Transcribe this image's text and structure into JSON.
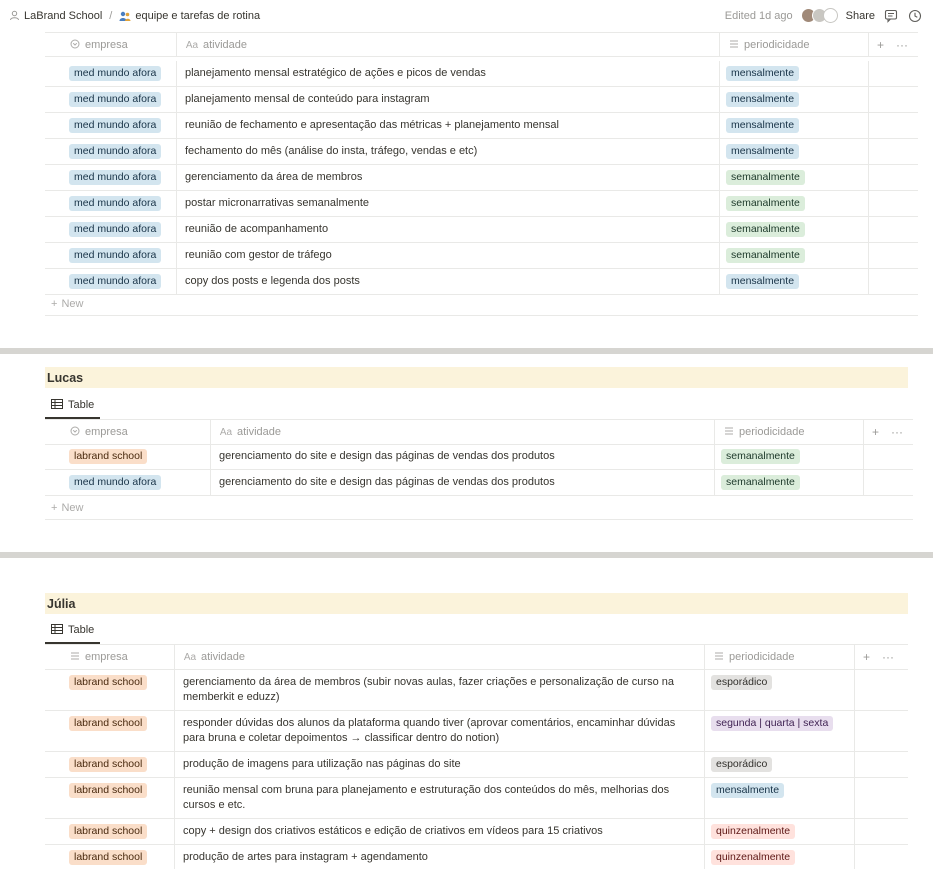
{
  "topbar": {
    "workspace": "LaBrand School",
    "separator": "/",
    "page": "equipe e tarefas de rotina",
    "edited": "Edited 1d ago",
    "share": "Share"
  },
  "icons": {
    "workspace": "user-icon",
    "page": "people-icon",
    "comments": "comment-icon",
    "history": "clock-icon",
    "select_prop": "select-property-icon",
    "title_prop": "text-property-icon",
    "multi_prop": "list-property-icon",
    "add": "plus-icon",
    "more": "ellipsis-icon",
    "table_view": "table-icon"
  },
  "columns": {
    "empresa": "empresa",
    "atividade": "atividade",
    "periodicidade": "periodicidade",
    "title_prefix": "Aa"
  },
  "new_label": "New",
  "plus": "+",
  "dots": "···",
  "table1": {
    "rows": [
      {
        "empresa": "med mundo afora",
        "atividade": "planejamento mensal estratégico de ações e picos de vendas",
        "periodicidade": "mensalmente"
      },
      {
        "empresa": "med mundo afora",
        "atividade": "planejamento mensal de conteúdo para instagram",
        "periodicidade": "mensalmente"
      },
      {
        "empresa": "med mundo afora",
        "atividade": "reunião de fechamento e apresentação das métricas + planejamento mensal",
        "periodicidade": "mensalmente"
      },
      {
        "empresa": "med mundo afora",
        "atividade": "fechamento do mês (análise do insta, tráfego, vendas e etc)",
        "periodicidade": "mensalmente"
      },
      {
        "empresa": "med mundo afora",
        "atividade": "gerenciamento da área de membros",
        "periodicidade": "semanalmente"
      },
      {
        "empresa": "med mundo afora",
        "atividade": "postar micronarrativas semanalmente",
        "periodicidade": "semanalmente"
      },
      {
        "empresa": "med mundo afora",
        "atividade": "reunião de acompanhamento",
        "periodicidade": "semanalmente"
      },
      {
        "empresa": "med mundo afora",
        "atividade": "reunião com gestor de tráfego",
        "periodicidade": "semanalmente"
      },
      {
        "empresa": "med mundo afora",
        "atividade": "copy dos posts e legenda dos posts",
        "periodicidade": "mensalmente"
      }
    ]
  },
  "lucas": {
    "title": "Lucas",
    "view": "Table",
    "rows": [
      {
        "empresa": "labrand school",
        "atividade": "gerenciamento do site e design das páginas de vendas dos produtos",
        "periodicidade": "semanalmente"
      },
      {
        "empresa": "med mundo afora",
        "atividade": "gerenciamento do site e design das páginas de vendas dos produtos",
        "periodicidade": "semanalmente"
      }
    ]
  },
  "julia": {
    "title": "Júlia",
    "view": "Table",
    "rows": [
      {
        "empresa": "labrand school",
        "atividade": "gerenciamento da área de membros (subir novas aulas, fazer criações e personalização de curso na memberkit e eduzz)",
        "periodicidade": "esporádico"
      },
      {
        "empresa": "labrand school",
        "atividade": "responder dúvidas dos alunos da plataforma quando tiver (aprovar comentários, encaminhar dúvidas para bruna e coletar depoimentos → classificar dentro do notion)",
        "periodicidade": "segunda | quarta | sexta"
      },
      {
        "empresa": "labrand school",
        "atividade": "produção de imagens para utilização nas páginas do site",
        "periodicidade": "esporádico"
      },
      {
        "empresa": "labrand school",
        "atividade": "reunião mensal com bruna para planejamento e estruturação dos conteúdos do mês, melhorias dos cursos e etc.",
        "periodicidade": "mensalmente"
      },
      {
        "empresa": "labrand school",
        "atividade": "copy + design dos criativos estáticos e edição de criativos em vídeos para 15 criativos",
        "periodicidade": "quinzenalmente"
      },
      {
        "empresa": "labrand school",
        "atividade": "produção de artes para instagram + agendamento",
        "periodicidade": "quinzenalmente"
      }
    ]
  },
  "colors": {
    "mensalmente": "#d3e5ef",
    "semanalmente": "#dbeddb",
    "esporadico": "#e3e2e0",
    "segunda_quarta_sexta": "#e8deee",
    "quinzenalmente": "#ffe2dd",
    "labrand_school": "#fadec9",
    "med_mundo_afora": "#d3e5ef",
    "group_title_bg": "#fbf3db"
  }
}
